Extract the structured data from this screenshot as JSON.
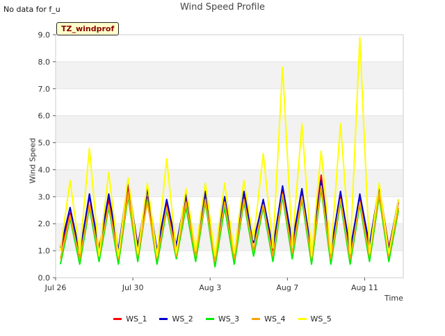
{
  "note": "No data for f_u",
  "chart_data": {
    "type": "line",
    "title": "Wind Speed Profile",
    "xlabel": "Time",
    "ylabel": "Wind Speed",
    "site_label": "TZ_windprof",
    "ylim": [
      0,
      9
    ],
    "yticks": [
      "0.0",
      "1.0",
      "2.0",
      "3.0",
      "4.0",
      "5.0",
      "6.0",
      "7.0",
      "8.0",
      "9.0"
    ],
    "xlim": [
      "2022-07-26",
      "2022-08-13"
    ],
    "xticks": [
      {
        "label": "Jul 26",
        "date": "2022-07-26"
      },
      {
        "label": "Jul 30",
        "date": "2022-07-30"
      },
      {
        "label": "Aug 3",
        "date": "2022-08-03"
      },
      {
        "label": "Aug 7",
        "date": "2022-08-07"
      },
      {
        "label": "Aug 11",
        "date": "2022-08-11"
      }
    ],
    "grid": true,
    "legend_position": "bottom",
    "x": [
      "2022-07-26T06:00",
      "2022-07-26T18:00",
      "2022-07-27T06:00",
      "2022-07-27T18:00",
      "2022-07-28T06:00",
      "2022-07-28T18:00",
      "2022-07-29T06:00",
      "2022-07-29T18:00",
      "2022-07-30T06:00",
      "2022-07-30T18:00",
      "2022-07-31T06:00",
      "2022-07-31T18:00",
      "2022-08-01T06:00",
      "2022-08-01T18:00",
      "2022-08-02T06:00",
      "2022-08-02T18:00",
      "2022-08-03T06:00",
      "2022-08-03T18:00",
      "2022-08-04T06:00",
      "2022-08-04T18:00",
      "2022-08-05T06:00",
      "2022-08-05T18:00",
      "2022-08-06T06:00",
      "2022-08-06T18:00",
      "2022-08-07T06:00",
      "2022-08-07T18:00",
      "2022-08-08T06:00",
      "2022-08-08T18:00",
      "2022-08-09T06:00",
      "2022-08-09T18:00",
      "2022-08-10T06:00",
      "2022-08-10T18:00",
      "2022-08-11T06:00",
      "2022-08-11T18:00",
      "2022-08-12T06:00",
      "2022-08-12T18:00"
    ],
    "series": [
      {
        "name": "WS_1",
        "color": "#ff0000",
        "values": [
          1.0,
          2.4,
          0.8,
          3.0,
          1.1,
          2.9,
          0.9,
          3.4,
          1.2,
          3.0,
          0.9,
          2.8,
          1.1,
          3.0,
          1.0,
          3.0,
          0.8,
          2.9,
          0.9,
          3.0,
          1.4,
          2.8,
          1.0,
          3.3,
          1.2,
          3.2,
          0.9,
          3.8,
          0.9,
          3.1,
          1.1,
          2.9,
          1.1,
          3.4,
          1.1,
          2.8
        ]
      },
      {
        "name": "WS_2",
        "color": "#0000cc",
        "values": [
          1.1,
          2.6,
          0.9,
          3.1,
          1.0,
          3.1,
          1.0,
          3.6,
          1.1,
          3.3,
          1.0,
          2.9,
          1.2,
          3.1,
          0.9,
          3.2,
          0.7,
          3.0,
          0.8,
          3.2,
          1.3,
          2.9,
          1.1,
          3.4,
          1.3,
          3.3,
          0.9,
          3.6,
          1.0,
          3.2,
          1.0,
          3.1,
          1.2,
          3.4,
          1.0,
          2.9
        ]
      },
      {
        "name": "WS_3",
        "color": "#00ee00",
        "values": [
          0.5,
          2.2,
          0.5,
          2.6,
          0.6,
          2.6,
          0.5,
          3.0,
          0.6,
          2.9,
          0.5,
          2.5,
          0.7,
          2.6,
          0.6,
          2.8,
          0.4,
          2.6,
          0.5,
          2.8,
          0.8,
          2.6,
          0.6,
          3.0,
          0.7,
          2.9,
          0.5,
          3.3,
          0.5,
          2.8,
          0.5,
          2.7,
          0.6,
          3.0,
          0.6,
          2.5
        ]
      },
      {
        "name": "WS_4",
        "color": "#ffa500",
        "values": [
          0.7,
          2.3,
          0.7,
          2.7,
          0.8,
          2.7,
          0.7,
          3.1,
          0.8,
          2.8,
          0.7,
          2.6,
          0.8,
          2.8,
          0.8,
          2.9,
          0.6,
          2.8,
          0.7,
          2.9,
          1.0,
          2.7,
          0.8,
          3.1,
          0.9,
          3.0,
          0.7,
          3.4,
          0.7,
          2.9,
          0.7,
          2.8,
          0.8,
          3.1,
          0.8,
          2.6
        ]
      },
      {
        "name": "WS_5",
        "color": "#ffff00",
        "values": [
          1.0,
          3.6,
          0.9,
          4.8,
          0.8,
          3.9,
          0.8,
          3.7,
          0.9,
          3.5,
          0.8,
          4.4,
          0.9,
          3.3,
          1.0,
          3.5,
          0.8,
          3.5,
          0.9,
          3.6,
          1.4,
          4.6,
          1.1,
          7.8,
          1.2,
          5.7,
          0.8,
          4.7,
          0.9,
          5.7,
          0.9,
          8.9,
          0.9,
          3.5,
          0.9,
          2.9
        ]
      }
    ]
  }
}
